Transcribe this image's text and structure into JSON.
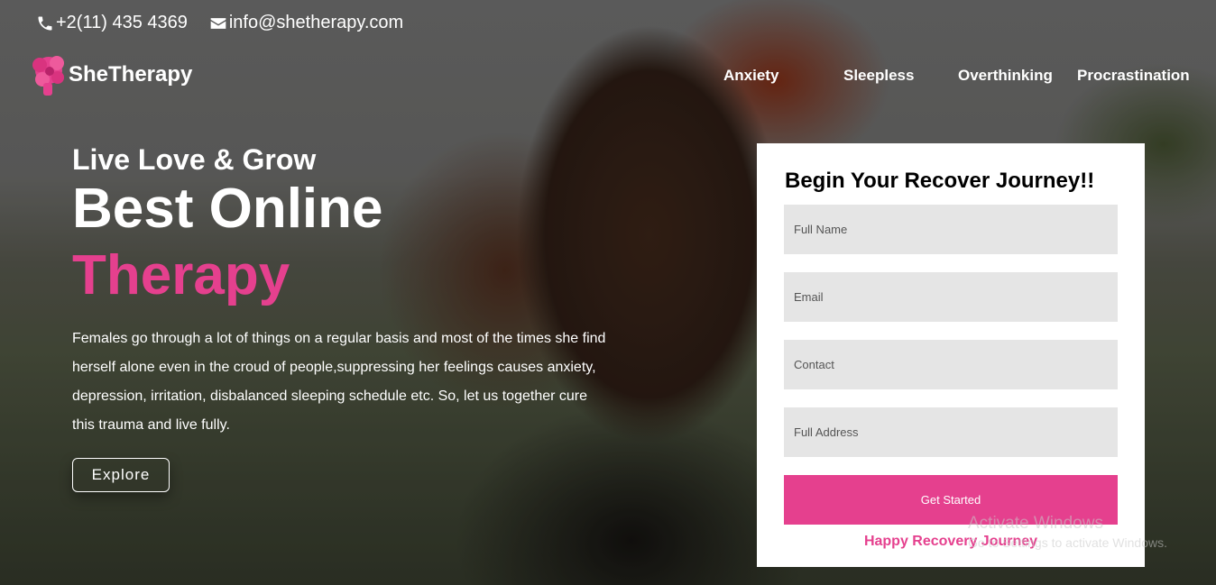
{
  "topbar": {
    "phone": "+2(11) 435 4369",
    "email": "info@shetherapy.com",
    "phone_icon": "phone-icon",
    "email_icon": "envelope-icon"
  },
  "brand": {
    "name": "SheTherapy",
    "logo_icon": "flower-head-logo-icon"
  },
  "nav": {
    "items": [
      "Anxiety",
      "Sleepless",
      "Overthinking",
      "Procrastination"
    ]
  },
  "hero": {
    "tagline": "Live Love & Grow",
    "headline": "Best Online",
    "headline_accent": "Therapy",
    "description": "Females go through a lot of things on a regular basis and most of the times she find herself alone even in the croud of people,suppressing her feelings causes anxiety, depression, irritation, disbalanced sleeping schedule etc. So, let us together cure this trauma and live fully.",
    "cta": "Explore"
  },
  "form": {
    "title": "Begin Your Recover Journey!!",
    "fields": {
      "full_name": "Full Name",
      "email": "Email",
      "contact": "Contact",
      "address": "Full Address"
    },
    "submit": "Get Started",
    "footer": "Happy Recovery Journey"
  },
  "watermark": {
    "title": "Activate Windows",
    "subtitle": "Go to Settings to activate Windows."
  },
  "colors": {
    "accent": "#e5408e",
    "field_bg": "#e5e5e5",
    "card_bg": "#ffffff"
  }
}
